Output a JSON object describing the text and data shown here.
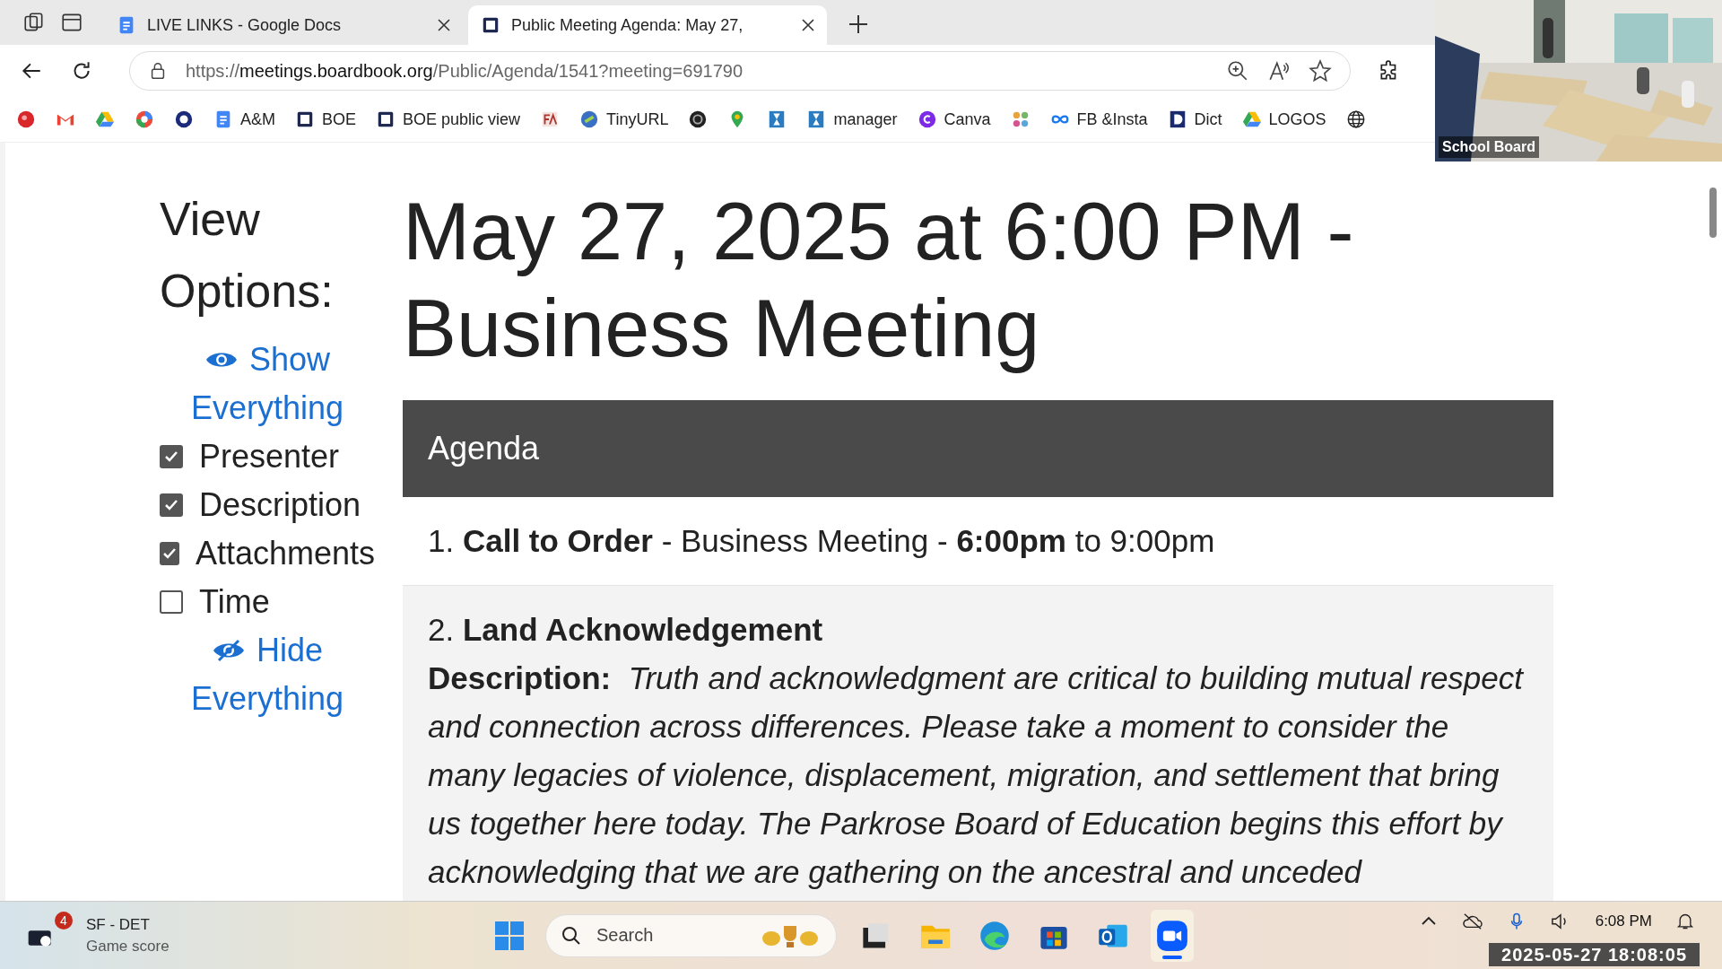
{
  "browser": {
    "tabs": [
      {
        "title": "LIVE LINKS - Google Docs",
        "selected": false,
        "kind": "docs"
      },
      {
        "title": "Public Meeting Agenda: May 27, ",
        "selected": true,
        "kind": "board"
      }
    ],
    "url": {
      "scheme": "https://",
      "domain": "meetings.boardbook.org",
      "path": "/Public/Agenda/1541?meeting=691790"
    },
    "bookmarks": [
      {
        "kind": "red"
      },
      {
        "kind": "mail"
      },
      {
        "kind": "drive"
      },
      {
        "kind": "pinwheel"
      },
      {
        "kind": "ring"
      },
      {
        "label": "A&M",
        "kind": "docs"
      },
      {
        "label": "BOE",
        "kind": "board"
      },
      {
        "label": "BOE public view",
        "kind": "board"
      },
      {
        "kind": "fa"
      },
      {
        "label": "TinyURL",
        "kind": "link"
      },
      {
        "kind": "dark"
      },
      {
        "kind": "pin"
      },
      {
        "kind": "hourglass"
      },
      {
        "label": "manager",
        "kind": "hourglass"
      },
      {
        "label": "Canva",
        "kind": "canva"
      },
      {
        "kind": "apps"
      },
      {
        "label": "FB &Insta",
        "kind": "infinity"
      },
      {
        "label": "Dict",
        "kind": "dict"
      },
      {
        "label": "LOGOS",
        "kind": "drive"
      },
      {
        "kind": "globe"
      }
    ]
  },
  "video": {
    "label": "School Board"
  },
  "view_options": {
    "title": "View Options:",
    "show_all": "Show Everything",
    "options": [
      {
        "label": "Presenter",
        "checked": true
      },
      {
        "label": "Description",
        "checked": true
      },
      {
        "label": "Attachments",
        "checked": true
      },
      {
        "label": "Time",
        "checked": false
      }
    ],
    "hide_all": "Hide Everything"
  },
  "meeting_title": "May 27, 2025 at 6:00 PM - Business Meeting",
  "agenda": {
    "header": "Agenda",
    "items": [
      {
        "heading": "1. **Call to Order** - Business Meeting - **6:00pm** to 9:00pm",
        "highlighted": false
      },
      {
        "heading": "2. **Land Acknowledgement**",
        "highlighted": true,
        "description_label": "Description:",
        "description": "Truth and acknowledgment are critical to building mutual respect and connection across differences. Please take a moment to consider the many legacies of violence, displacement, migration, and settlement that bring us together here today. The Parkrose Board of Education begins this effort by acknowledging that we are gathering on the ancestral and unceded"
      }
    ]
  },
  "taskbar": {
    "widget": {
      "title": "SF - DET",
      "subtitle": "Game score",
      "badge": "4"
    },
    "search": {
      "placeholder": "Search"
    },
    "apps": [
      {
        "kind": "window",
        "active": false
      },
      {
        "kind": "folder",
        "active": false
      },
      {
        "kind": "edge",
        "active": false
      },
      {
        "kind": "store",
        "active": false
      },
      {
        "kind": "outlook",
        "active": false
      },
      {
        "kind": "zoom",
        "active": true
      }
    ],
    "time": "6:08 PM",
    "timestamp": "2025-05-27 18:08:05"
  }
}
